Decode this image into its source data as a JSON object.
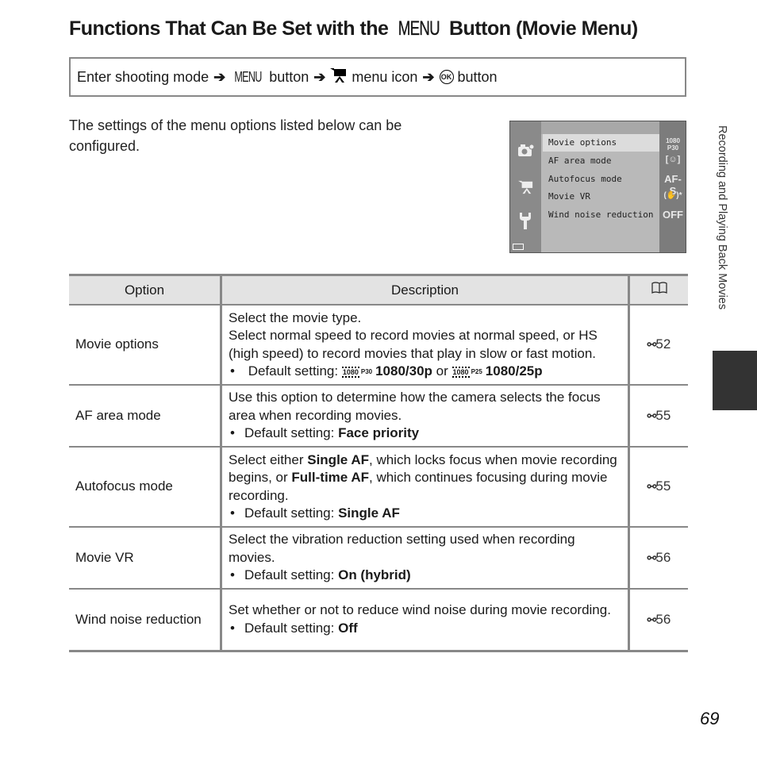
{
  "page": {
    "title_prefix": "Functions That Can Be Set with the",
    "title_menu_glyph": "MENU",
    "title_suffix": "Button (Movie Menu)",
    "nav": {
      "step1": "Enter shooting mode",
      "arrow": "➔",
      "menu_glyph": "MENU",
      "step2": "button",
      "movie_icon": "🎥",
      "step3": "menu icon",
      "ok_glyph": "OK",
      "step4": "button"
    },
    "intro": "The settings of the menu options listed below can be configured.",
    "side_label": "Recording and Playing Back Movies",
    "page_number": "69"
  },
  "camera_screen": {
    "tab_icons": [
      "camera-icon",
      "movie-icon",
      "wrench-icon"
    ],
    "items": [
      {
        "label": "Movie options",
        "value": "1080 P30",
        "selected": true
      },
      {
        "label": "AF area mode",
        "value": "[☺]"
      },
      {
        "label": "Autofocus mode",
        "value": "AF-S"
      },
      {
        "label": "Movie VR",
        "value": "(✋)*"
      },
      {
        "label": "Wind noise reduction",
        "value": "OFF"
      }
    ]
  },
  "table": {
    "headers": {
      "option": "Option",
      "description": "Description",
      "ref": "📖"
    },
    "ref_prefix": "⚯",
    "default_label": "Default setting:",
    "rows": [
      {
        "option": "Movie options",
        "lines": [
          "Select the movie type.",
          "Select normal speed to record movies at normal speed, or HS (high speed) to record movies that play in slow or fast motion."
        ],
        "default_a_icon": "1080",
        "default_a_fps": "P30",
        "default_a": "1080/30p",
        "default_or": "or",
        "default_b_icon": "1080",
        "default_b_fps": "P25",
        "default_b": "1080/25p",
        "ref": "52"
      },
      {
        "option": "AF area mode",
        "lines": [
          "Use this option to determine how the camera selects the focus area when recording movies."
        ],
        "default": "Face priority",
        "ref": "55"
      },
      {
        "option": "Autofocus mode",
        "pre": "Select either",
        "b1": "Single AF",
        "mid": ", which locks focus when movie recording begins, or",
        "b2": "Full-time AF",
        "post": ", which continues focusing during movie recording.",
        "default": "Single AF",
        "ref": "55"
      },
      {
        "option": "Movie VR",
        "lines": [
          "Select the vibration reduction setting used when recording movies."
        ],
        "default": "On (hybrid)",
        "ref": "56"
      },
      {
        "option": "Wind noise reduction",
        "lines": [
          "Set whether or not to reduce wind noise during movie recording."
        ],
        "default": "Off",
        "ref": "56"
      }
    ]
  }
}
